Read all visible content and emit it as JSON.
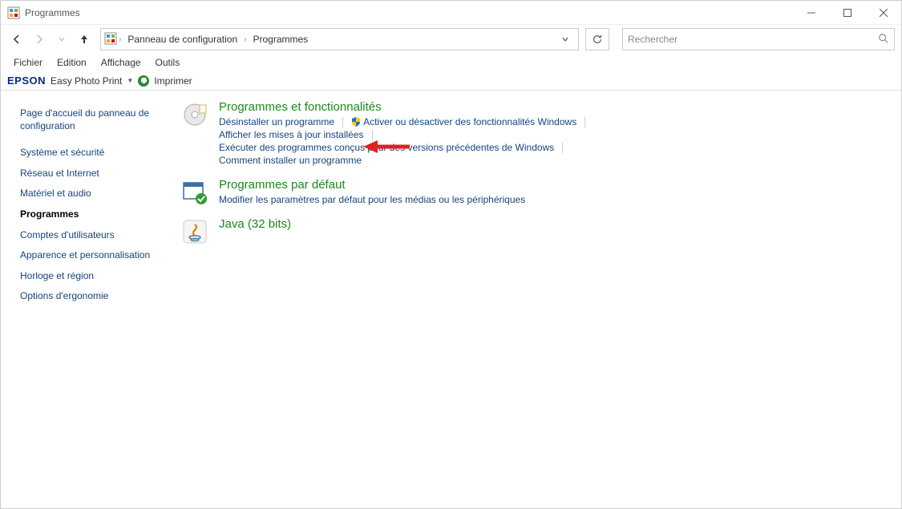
{
  "window": {
    "title": "Programmes"
  },
  "breadcrumb": {
    "root": "Panneau de configuration",
    "current": "Programmes"
  },
  "search": {
    "placeholder": "Rechercher"
  },
  "menubar": {
    "file": "Fichier",
    "edit": "Edition",
    "view": "Affichage",
    "tools": "Outils"
  },
  "epson": {
    "brand": "EPSON",
    "easy_photo": "Easy Photo Print",
    "print": "Imprimer"
  },
  "sidebar": {
    "home": "Page d'accueil du panneau de configuration",
    "items": [
      "Système et sécurité",
      "Réseau et Internet",
      "Matériel et audio",
      "Programmes",
      "Comptes d'utilisateurs",
      "Apparence et personnalisation",
      "Horloge et région",
      "Options d'ergonomie"
    ],
    "current_index": 3
  },
  "categories": {
    "programs_features": {
      "title": "Programmes et fonctionnalités",
      "links": {
        "uninstall": "Désinstaller un programme",
        "windows_features": "Activer ou désactiver des fonctionnalités Windows",
        "view_updates": "Afficher les mises à jour installées",
        "compat": "Exécuter des programmes conçus pour des versions précédentes de Windows",
        "how_install": "Comment installer un programme"
      }
    },
    "default_programs": {
      "title": "Programmes par défaut",
      "links": {
        "modify": "Modifier les paramètres par défaut pour les médias ou les périphériques"
      }
    },
    "java": {
      "title": "Java (32 bits)"
    }
  }
}
